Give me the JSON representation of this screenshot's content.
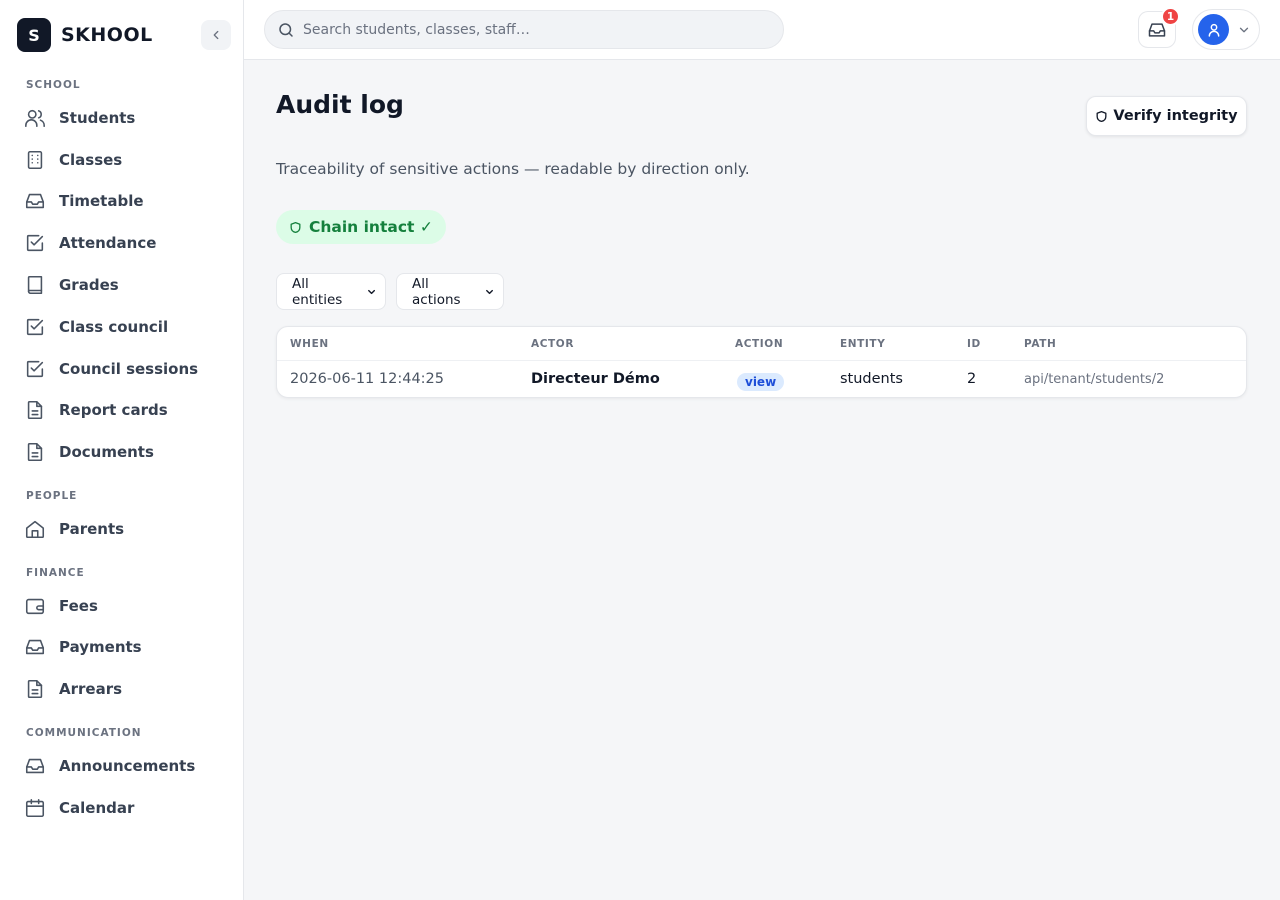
{
  "brand": {
    "logo_letter": "S",
    "name": "SKHOOL"
  },
  "sidebar": {
    "sections": [
      {
        "title": "SCHOOL"
      },
      {
        "title": "PEOPLE"
      },
      {
        "title": "FINANCE"
      },
      {
        "title": "COMMUNICATION"
      }
    ],
    "items": [
      {
        "label": "Students",
        "icon": "users-icon"
      },
      {
        "label": "Classes",
        "icon": "building-icon"
      },
      {
        "label": "Timetable",
        "icon": "inbox-icon"
      },
      {
        "label": "Attendance",
        "icon": "check-square-icon"
      },
      {
        "label": "Grades",
        "icon": "book-icon"
      },
      {
        "label": "Class council",
        "icon": "check-square-icon"
      },
      {
        "label": "Council sessions",
        "icon": "check-square-icon"
      },
      {
        "label": "Report cards",
        "icon": "file-text-icon"
      },
      {
        "label": "Documents",
        "icon": "file-text-icon"
      },
      {
        "label": "Parents",
        "icon": "home-icon"
      },
      {
        "label": "Fees",
        "icon": "wallet-icon"
      },
      {
        "label": "Payments",
        "icon": "inbox-icon"
      },
      {
        "label": "Arrears",
        "icon": "file-text-icon"
      },
      {
        "label": "Announcements",
        "icon": "inbox-icon"
      },
      {
        "label": "Calendar",
        "icon": "calendar-icon"
      }
    ]
  },
  "topbar": {
    "search_placeholder": "Search students, classes, staff…",
    "notification_count": "1"
  },
  "main": {
    "title": "Audit log",
    "verify_label": "Verify integrity",
    "subtitle": "Traceability of sensitive actions — readable by direction only.",
    "chain_status": "Chain intact ✓",
    "filters": {
      "entities": "All entities",
      "actions": "All actions"
    },
    "table": {
      "headers": [
        "WHEN",
        "ACTOR",
        "ACTION",
        "ENTITY",
        "ID",
        "PATH"
      ],
      "rows": [
        {
          "when": "2026-06-11 12:44:25",
          "actor": "Directeur Démo",
          "action": "view",
          "entity": "students",
          "id": "2",
          "path": "api/tenant/students/2"
        }
      ]
    }
  },
  "colors": {
    "accent": "#2563eb",
    "success": "#15803d",
    "danger": "#ef4444",
    "brand_dark": "#111827"
  }
}
